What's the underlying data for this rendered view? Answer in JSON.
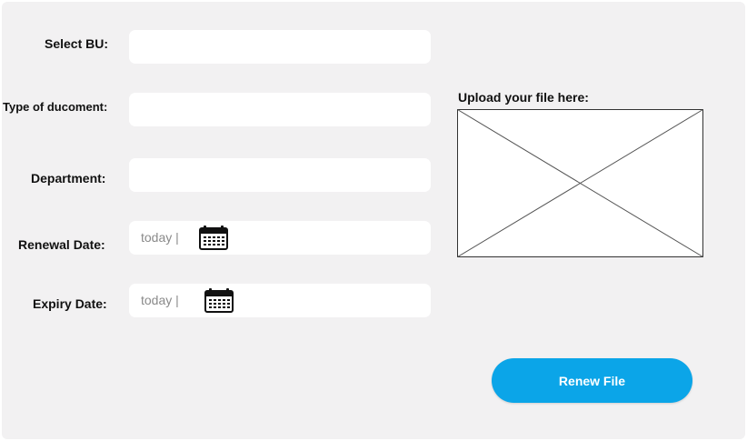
{
  "form": {
    "select_bu_label": "Select BU:",
    "doc_type_label": "Type of ducoment:",
    "department_label": "Department:",
    "renewal_label": "Renewal Date:",
    "renewal_value": "today |",
    "expiry_label": "Expiry Date:",
    "expiry_value": "today |",
    "upload_label": "Upload your file here:",
    "submit_label": "Renew File"
  },
  "icons": {
    "date_picker": "calendar-icon",
    "upload_placeholder": "image-placeholder-icon"
  },
  "colors": {
    "panel": "#f2f1f2",
    "field": "#ffffff",
    "button": "#0ba5e8",
    "placeholder_text": "#8a8a8a"
  }
}
